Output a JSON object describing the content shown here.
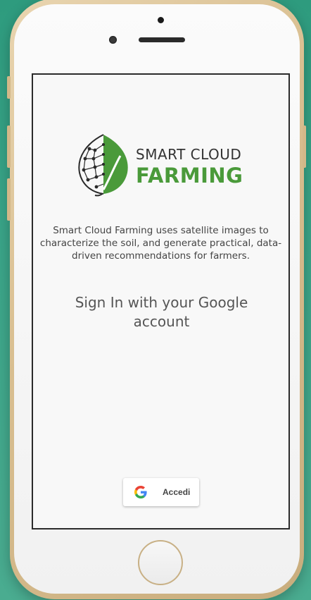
{
  "brand": {
    "line1": "SMART CLOUD",
    "line2": "FARMING",
    "primary_color": "#4a9a3a",
    "icon": "leaf-logo-icon"
  },
  "description": "Smart Cloud Farming uses satellite images to characterize the soil, and generate practical, data-driven recommendations for farmers.",
  "signin": {
    "heading": "Sign In with your Google account",
    "button_label": "Accedi",
    "button_icon": "google-g-icon"
  },
  "colors": {
    "background": "#3aa488",
    "phone_frame": "#d9bf91",
    "screen_bg": "#f8f8f8"
  }
}
